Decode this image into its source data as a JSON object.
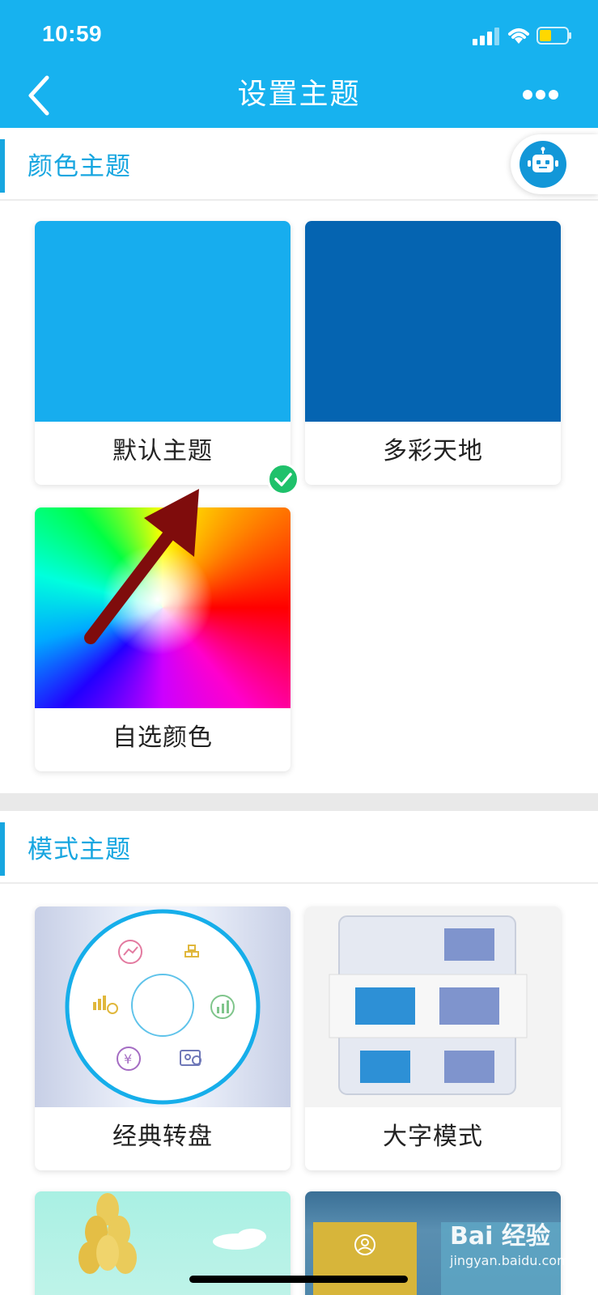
{
  "status_bar": {
    "time": "10:59"
  },
  "nav": {
    "title": "设置主题"
  },
  "color_section": {
    "title": "颜色主题",
    "themes": [
      {
        "label": "默认主题",
        "color": "#17adee",
        "selected": true
      },
      {
        "label": "多彩天地",
        "color": "#0564b1",
        "selected": false
      },
      {
        "label": "自选颜色",
        "color": "rainbow",
        "selected": false
      }
    ]
  },
  "mode_section": {
    "title": "模式主题",
    "themes": [
      {
        "label": "经典转盘"
      },
      {
        "label": "大字模式"
      }
    ]
  },
  "colors": {
    "brand": "#17b2ef",
    "accent": "#17a6e0",
    "check": "#1fc16b",
    "arrow": "#7f0c0c"
  },
  "watermark": {
    "main": "Bai 经验",
    "sub": "jingyan.baidu.com"
  }
}
